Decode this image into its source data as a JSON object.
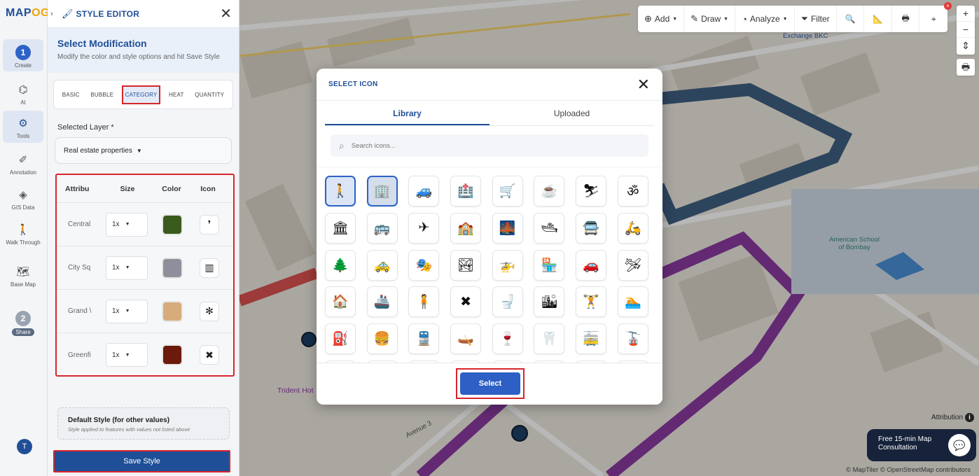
{
  "app": {
    "logo_main": "MAP",
    "logo_accent": "OG"
  },
  "rail": {
    "create_step": "1",
    "create_label": "Create",
    "ai_label": "AI",
    "tools_label": "Tools",
    "annotation_label": "Annotation",
    "gis_label": "GIS Data",
    "walk_label": "Walk Through",
    "basemap_label": "Base Map",
    "share_step": "2",
    "share_label": "Share",
    "user_initial": "T"
  },
  "panel": {
    "title": "STYLE EDITOR",
    "heading": "Select Modification",
    "description": "Modify the color and style options and hit Save Style",
    "tabs": [
      "BASIC",
      "BUBBLE",
      "CATEGORY",
      "HEAT",
      "QUANTITY"
    ],
    "active_tab": "CATEGORY",
    "layer_label": "Selected Layer *",
    "layer_value": "Real estate properties",
    "columns": [
      "Attribu",
      "Size",
      "Color",
      "Icon"
    ],
    "rows": [
      {
        "name": "Central",
        "size": "1x",
        "color": "#3b5a1e",
        "icon": "❜"
      },
      {
        "name": "City Sq",
        "size": "1x",
        "color": "#8d8f9a",
        "icon": "▥"
      },
      {
        "name": "Grand \\",
        "size": "1x",
        "color": "#d7ac7a",
        "icon": "✻"
      },
      {
        "name": "Greenfi",
        "size": "1x",
        "color": "#6b1a0b",
        "icon": "✖"
      }
    ],
    "default_title": "Default Style (for other values)",
    "default_sub": "Style applied to features with values not listed above",
    "save_label": "Save Style"
  },
  "toolbar": {
    "add": "Add",
    "draw": "Draw",
    "analyze": "Analyze",
    "filter": "Filter",
    "notif": "×"
  },
  "map": {
    "label_exchange": "Exchange BKC",
    "label_school": "American School of Bombay",
    "label_trident": "Trident Hot",
    "label_avenue3": "Avenue 3",
    "attribution": "Attribution",
    "consult": "Free 15-min Map Consultation",
    "credits": "© MapTiler © OpenStreetMap contributors",
    "colors": {
      "blue_route": "#3f5f82",
      "purple_route": "#8b3aa0",
      "red_route": "#d9534f"
    }
  },
  "modal": {
    "title": "SELECT ICON",
    "tab_library": "Library",
    "tab_uploaded": "Uploaded",
    "search_placeholder": "Search icons...",
    "select_label": "Select",
    "icons": [
      {
        "name": "pedestrian-icon",
        "glyph": "🚶"
      },
      {
        "name": "building-tower-icon",
        "glyph": "🏢"
      },
      {
        "name": "atv-icon",
        "glyph": "🚙"
      },
      {
        "name": "hospital-building-icon",
        "glyph": "🏥"
      },
      {
        "name": "shopping-cart-icon",
        "glyph": "🛒"
      },
      {
        "name": "coffee-cup-icon",
        "glyph": "☕"
      },
      {
        "name": "skier-icon",
        "glyph": "⛷"
      },
      {
        "name": "om-icon",
        "glyph": "ॐ"
      },
      {
        "name": "bank-icon",
        "glyph": "🏛"
      },
      {
        "name": "bus-icon",
        "glyph": "🚌"
      },
      {
        "name": "airplane-icon",
        "glyph": "✈"
      },
      {
        "name": "school-icon",
        "glyph": "🏫"
      },
      {
        "name": "bridge-icon",
        "glyph": "🌉"
      },
      {
        "name": "boat-icon",
        "glyph": "🛥"
      },
      {
        "name": "bus-front-icon",
        "glyph": "🚍"
      },
      {
        "name": "scooter-icon",
        "glyph": "🛵"
      },
      {
        "name": "park-icon",
        "glyph": "🌲"
      },
      {
        "name": "taxi-icon",
        "glyph": "🚕"
      },
      {
        "name": "theater-mask-icon",
        "glyph": "🎭"
      },
      {
        "name": "landscape-icon",
        "glyph": "🏞"
      },
      {
        "name": "helicopter-icon",
        "glyph": "🚁"
      },
      {
        "name": "store-icon",
        "glyph": "🏪"
      },
      {
        "name": "car-icon",
        "glyph": "🚗"
      },
      {
        "name": "small-plane-icon",
        "glyph": "🛩"
      },
      {
        "name": "lighthouse-icon",
        "glyph": "🏠"
      },
      {
        "name": "ship-icon",
        "glyph": "🚢"
      },
      {
        "name": "person-standing-icon",
        "glyph": "🧍"
      },
      {
        "name": "windmill-icon",
        "glyph": "✖"
      },
      {
        "name": "toilet-icon",
        "glyph": "🚽"
      },
      {
        "name": "city-buildings-icon",
        "glyph": "🏙"
      },
      {
        "name": "dumbbell-icon",
        "glyph": "🏋"
      },
      {
        "name": "swimming-icon",
        "glyph": "🏊"
      },
      {
        "name": "ev-charging-icon",
        "glyph": "⛽"
      },
      {
        "name": "burger-icon",
        "glyph": "🍔"
      },
      {
        "name": "train-icon",
        "glyph": "🚆"
      },
      {
        "name": "kayak-icon",
        "glyph": "🛶"
      },
      {
        "name": "wine-glass-icon",
        "glyph": "🍷"
      },
      {
        "name": "tooth-icon",
        "glyph": "🦷"
      },
      {
        "name": "tram-icon",
        "glyph": "🚋"
      },
      {
        "name": "cable-car-icon",
        "glyph": "🚡"
      }
    ]
  }
}
